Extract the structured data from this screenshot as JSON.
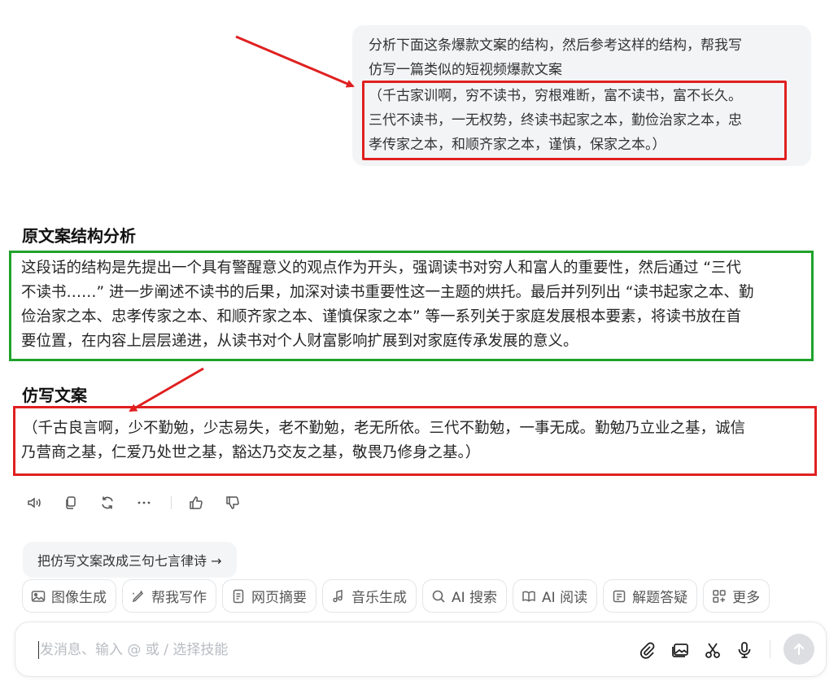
{
  "user_message": {
    "lines": [
      "分析下面这条爆款文案的结构，然后参考这样的结构，帮我写",
      "仿写一篇类似的短视频爆款文案",
      "（千古家训啊，穷不读书，穷根难断，富不读书，富不长久。",
      "三代不读书，一无权势，终读书起家之本，勤俭治家之本，忠",
      "孝传家之本，和顺齐家之本，谨慎，保家之本。）"
    ]
  },
  "analysis": {
    "title": "原文案结构分析",
    "lines": [
      "这段话的结构是先提出一个具有警醒意义的观点作为开头，强调读书对穷人和富人的重要性，然后通过 “三代",
      "不读书……” 进一步阐述不读书的后果，加深对读书重要性这一主题的烘托。最后并列列出 “读书起家之本、勤",
      "俭治家之本、忠孝传家之本、和顺齐家之本、谨慎保家之本” 等一系列关于家庭发展根本要素，将读书放在首",
      "要位置，在内容上层层递进，从读书对个人财富影响扩展到对家庭传承发展的意义。"
    ]
  },
  "imitation": {
    "title": "仿写文案",
    "lines": [
      "（千古良言啊，少不勤勉，少志易失，老不勤勉，老无所依。三代不勤勉，一事无成。勤勉乃立业之基，诚信",
      "乃营商之基，仁爱乃处世之基，豁达乃交友之基，敬畏乃修身之基。）"
    ]
  },
  "actions": [
    "speaker-icon",
    "copy-icon",
    "regenerate-icon",
    "more-icon",
    "thumbs-up-icon",
    "thumbs-down-icon"
  ],
  "suggestion": "把仿写文案改成三句七言律诗 →",
  "skills": [
    {
      "label": "图像生成",
      "icon": "image-icon"
    },
    {
      "label": "帮我写作",
      "icon": "pen-icon"
    },
    {
      "label": "网页摘要",
      "icon": "document-icon"
    },
    {
      "label": "音乐生成",
      "icon": "music-icon"
    },
    {
      "label": "AI 搜索",
      "icon": "search-icon"
    },
    {
      "label": "AI 阅读",
      "icon": "book-icon"
    },
    {
      "label": "解题答疑",
      "icon": "question-icon"
    },
    {
      "label": "更多",
      "icon": "grid-icon"
    }
  ],
  "input": {
    "placeholder": "发消息、输入 @ 或 / 选择技能"
  },
  "colors": {
    "red_annotation": "#e02020",
    "green_annotation": "#1fa22b",
    "bubble_bg": "#f3f4f6"
  }
}
